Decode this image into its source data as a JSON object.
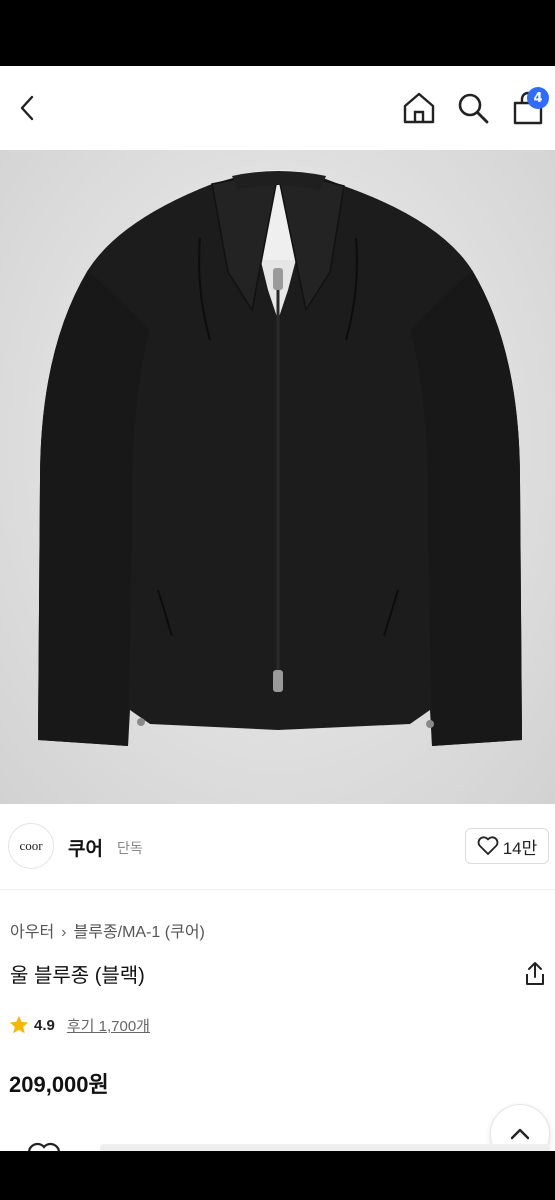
{
  "header": {
    "back_icon": "chevron-left-icon",
    "home_icon": "home-icon",
    "search_icon": "search-icon",
    "cart_icon": "shopping-bag-icon",
    "cart_count": "4"
  },
  "product_image": {
    "subject": "black zip-up blouson jacket"
  },
  "brand": {
    "logo_text": "coor",
    "name": "쿠어",
    "tag": "단독",
    "like_count": "14만"
  },
  "product": {
    "breadcrumb": [
      "아우터",
      "블루종/MA-1 (쿠어)"
    ],
    "title": "울 블루종 (블랙)",
    "rating": "4.9",
    "reviews_label": "후기 1,700개",
    "price": "209,000원"
  },
  "colors": {
    "badge": "#2f6bff",
    "star": "#f5b700",
    "page_bg": "#ffffff"
  }
}
